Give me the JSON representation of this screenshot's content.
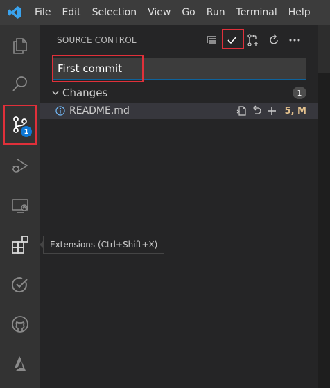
{
  "menu": [
    "File",
    "Edit",
    "Selection",
    "View",
    "Go",
    "Run",
    "Terminal",
    "Help"
  ],
  "activity_bar": {
    "items": [
      "explorer-icon",
      "search-icon",
      "source-control-icon",
      "run-debug-icon",
      "remote-explorer-icon",
      "extensions-icon",
      "testing-icon",
      "github-icon",
      "azure-icon"
    ],
    "source_control_badge": "1"
  },
  "source_control": {
    "title": "SOURCE CONTROL",
    "commit_message": "First commit",
    "changes_label": "Changes",
    "changes_count": "1",
    "files": [
      {
        "name": "README.md",
        "status": "5, M"
      }
    ]
  },
  "tooltip": "Extensions (Ctrl+Shift+X)",
  "colors": {
    "accent": "#0e78d5",
    "highlight": "#e0303a",
    "modified": "#e2c08d"
  }
}
